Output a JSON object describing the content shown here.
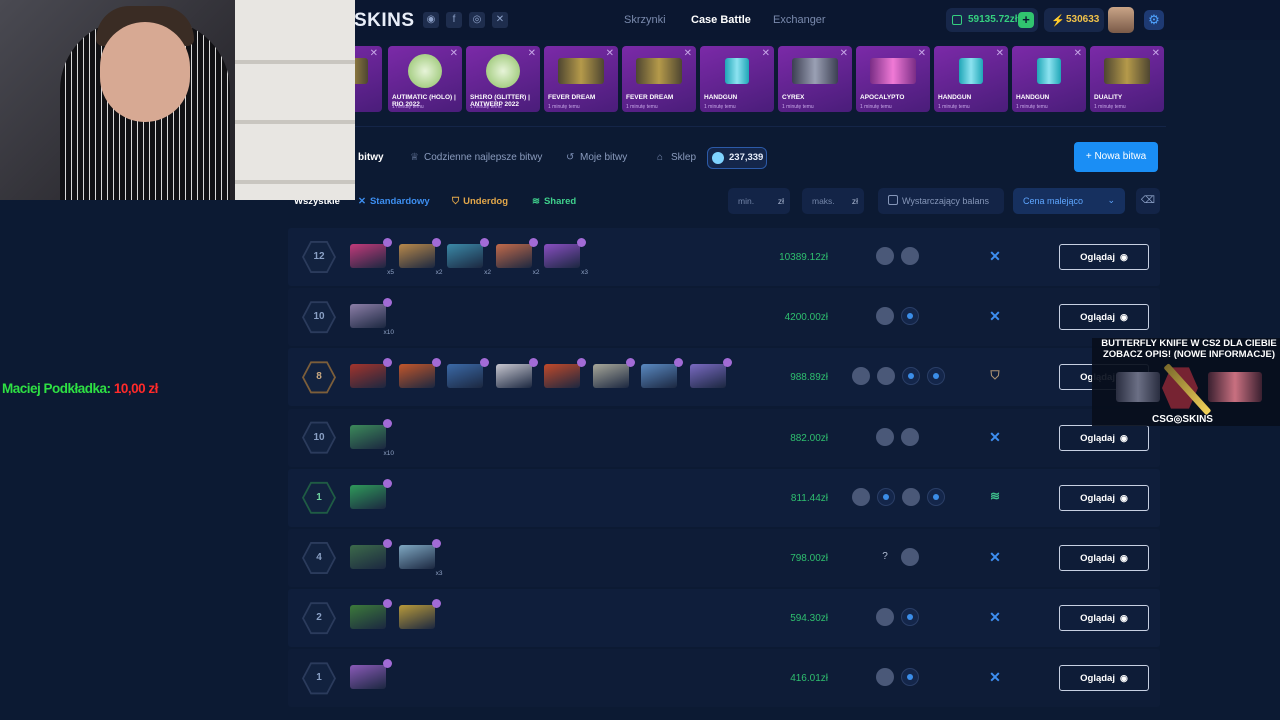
{
  "header": {
    "logo": "SKINS",
    "social": [
      {
        "name": "discord-icon",
        "glyph": "◉"
      },
      {
        "name": "facebook-icon",
        "glyph": "f"
      },
      {
        "name": "instagram-icon",
        "glyph": "◎"
      },
      {
        "name": "x-icon",
        "glyph": "✕"
      }
    ],
    "nav": [
      "Skrzynki",
      "Case Battle",
      "Exchanger"
    ],
    "active_nav": "Case Battle",
    "balance": "59135.72zł",
    "coins": "530633",
    "add_symbol": "+"
  },
  "ticker": [
    {
      "name": "",
      "sub": "",
      "style": "gold"
    },
    {
      "name": "AUTIMATIC (HOLO) | RIO 2022",
      "sub": "1 minutę temu",
      "style": "sticker"
    },
    {
      "name": "SH1RO (GLITTER) | ANTWERP 2022",
      "sub": "1 minutę temu",
      "style": "sticker"
    },
    {
      "name": "FEVER DREAM",
      "sub": "1 minutę temu",
      "style": "gold"
    },
    {
      "name": "FEVER DREAM",
      "sub": "1 minutę temu",
      "style": "gold"
    },
    {
      "name": "HANDGUN",
      "sub": "1 minutę temu",
      "style": "teal"
    },
    {
      "name": "CYREX",
      "sub": "1 minutę temu",
      "style": "plain"
    },
    {
      "name": "APOCALYPTO",
      "sub": "1 minutę temu",
      "style": "pink"
    },
    {
      "name": "HANDGUN",
      "sub": "1 minutę temu",
      "style": "teal"
    },
    {
      "name": "HANDGUN",
      "sub": "1 minutę temu",
      "style": "teal"
    },
    {
      "name": "DUALITY",
      "sub": "1 minutę temu",
      "style": "gold"
    }
  ],
  "tabs": {
    "items": [
      {
        "label": "bitwy",
        "icon": ""
      },
      {
        "label": "Codzienne najlepsze bitwy",
        "icon": "♕"
      },
      {
        "label": "Moje bitwy",
        "icon": "↺"
      },
      {
        "label": "Sklep",
        "icon": "⌂"
      }
    ],
    "points": "237,339",
    "new_battle": "+ Nowa bitwa"
  },
  "filters": {
    "all": "Wszystkie",
    "standard": "Standardowy",
    "underdog": "Underdog",
    "shared": "Shared",
    "min": "min.",
    "max": "maks.",
    "currency": "zł",
    "sufficient_balance": "Wystarczający balans",
    "sort": "Cena malejąco"
  },
  "watch_label": "Oglądaj",
  "battles": [
    {
      "rounds": "12",
      "hex": "plain",
      "price": "10389.12zł",
      "mode": "std",
      "cases": [
        {
          "c": "#c23a7a",
          "q": "x5"
        },
        {
          "c": "#b8894a",
          "q": "x2"
        },
        {
          "c": "#3b8aa8",
          "q": "x2"
        },
        {
          "c": "#c26a4a",
          "q": "x2"
        },
        {
          "c": "#8a4fc2",
          "q": "x3"
        }
      ],
      "players": [
        "avatar",
        "avatar"
      ]
    },
    {
      "rounds": "10",
      "hex": "plain",
      "price": "4200.00zł",
      "mode": "std",
      "cases": [
        {
          "c": "#8d7fa8",
          "q": "x10"
        }
      ],
      "players": [
        "avatar",
        "slot"
      ]
    },
    {
      "rounds": "8",
      "hex": "gold",
      "price": "988.89zł",
      "mode": "und",
      "cases": [
        {
          "c": "#a3342c",
          "q": ""
        },
        {
          "c": "#c2562a",
          "q": ""
        },
        {
          "c": "#3b6aa8",
          "q": ""
        },
        {
          "c": "#c7c7d0",
          "q": ""
        },
        {
          "c": "#c24a2a",
          "q": ""
        },
        {
          "c": "#a8a89a",
          "q": ""
        },
        {
          "c": "#5a8ac2",
          "q": ""
        },
        {
          "c": "#7a6ac2",
          "q": ""
        }
      ],
      "players": [
        "avatar",
        "avatar",
        "slot",
        "slot"
      ]
    },
    {
      "rounds": "10",
      "hex": "plain",
      "price": "882.00zł",
      "mode": "std",
      "cases": [
        {
          "c": "#3c8a5a",
          "q": "x10"
        }
      ],
      "players": [
        "avatar",
        "avatar"
      ]
    },
    {
      "rounds": "1",
      "hex": "green",
      "price": "811.44zł",
      "mode": "sha",
      "cases": [
        {
          "c": "#2f9a5a",
          "q": ""
        }
      ],
      "players": [
        "avatar",
        "slot",
        "avatar",
        "slot"
      ]
    },
    {
      "rounds": "4",
      "hex": "plain",
      "price": "798.00zł",
      "mode": "std",
      "cases": [
        {
          "c": "#3c6a4a",
          "q": ""
        },
        {
          "c": "#7fa8c2",
          "q": "x3"
        }
      ],
      "players": [
        "q",
        "avatar"
      ]
    },
    {
      "rounds": "2",
      "hex": "plain",
      "price": "594.30zł",
      "mode": "std",
      "cases": [
        {
          "c": "#3c7a3a",
          "q": ""
        },
        {
          "c": "#b89a3a",
          "q": ""
        }
      ],
      "players": [
        "avatar",
        "slot"
      ]
    },
    {
      "rounds": "1",
      "hex": "plain",
      "price": "416.01zł",
      "mode": "std",
      "cases": [
        {
          "c": "#8a5ab8",
          "q": ""
        }
      ],
      "players": [
        "avatar",
        "slot"
      ]
    }
  ],
  "overlay": {
    "donation_name": "Maciej Podkładka:",
    "donation_amount": "10,00 zł",
    "promo_line1": "BUTTERFLY KNIFE W CS2 DLA CIEBIE",
    "promo_line2": "ZOBACZ OPIS! (NOWE INFORMACJE)",
    "promo_brand": "CSG◎SKINS"
  },
  "colors": {
    "accent": "#1a8ef5",
    "price": "#2fbf6f",
    "donation_name": "#2ee043",
    "donation_amount": "#ff2a2a"
  }
}
